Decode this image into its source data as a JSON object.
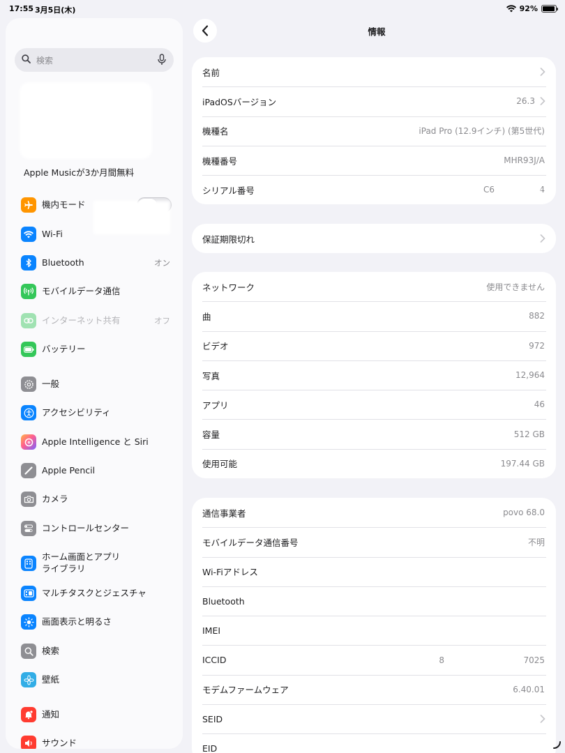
{
  "status": {
    "time": "17:55",
    "date": "3月5日(木)",
    "battery": "92%",
    "battery_level": 0.92
  },
  "sidebar": {
    "search_placeholder": "検索",
    "promo": "Apple Musicが3か月間無料",
    "items": [
      {
        "label": "機内モード",
        "value": "",
        "color": "#ff9500",
        "icon": "airplane-icon"
      },
      {
        "label": "Wi-Fi",
        "value": "",
        "color": "#0a84ff",
        "icon": "wifi-icon"
      },
      {
        "label": "Bluetooth",
        "value": "オン",
        "color": "#0a84ff",
        "icon": "bluetooth-icon"
      },
      {
        "label": "モバイルデータ通信",
        "value": "",
        "color": "#34c759",
        "icon": "antenna-icon"
      },
      {
        "label": "インターネット共有",
        "value": "オフ",
        "color": "#34c759",
        "icon": "link-icon"
      },
      {
        "label": "バッテリー",
        "value": "",
        "color": "#34c759",
        "icon": "battery-icon"
      },
      {
        "label": "一般",
        "value": "",
        "color": "#8e8e93",
        "icon": "gear-icon"
      },
      {
        "label": "アクセシビリティ",
        "value": "",
        "color": "#0a84ff",
        "icon": "accessibility-icon"
      },
      {
        "label": "Apple Intelligence と Siri",
        "value": "",
        "color": "#ff6ea8",
        "icon": "siri-icon"
      },
      {
        "label": "Apple Pencil",
        "value": "",
        "color": "#8e8e93",
        "icon": "pencil-icon"
      },
      {
        "label": "カメラ",
        "value": "",
        "color": "#8e8e93",
        "icon": "camera-icon"
      },
      {
        "label": "コントロールセンター",
        "value": "",
        "color": "#8e8e93",
        "icon": "toggles-icon"
      },
      {
        "label": "ホーム画面とアプリ",
        "label2": "ライブラリ",
        "value": "",
        "color": "#0a84ff",
        "icon": "home-screen-icon"
      },
      {
        "label": "マルチタスクとジェスチャ",
        "value": "",
        "color": "#0a84ff",
        "icon": "multitask-icon"
      },
      {
        "label": "画面表示と明るさ",
        "value": "",
        "color": "#0a84ff",
        "icon": "sun-icon"
      },
      {
        "label": "検索",
        "value": "",
        "color": "#8e8e93",
        "icon": "search-icon"
      },
      {
        "label": "壁紙",
        "value": "",
        "color": "#32ade6",
        "icon": "flower-icon"
      },
      {
        "label": "通知",
        "value": "",
        "color": "#ff3b30",
        "icon": "bell-icon"
      },
      {
        "label": "サウンド",
        "value": "",
        "color": "#ff3b30",
        "icon": "speaker-icon"
      }
    ]
  },
  "main": {
    "title": "情報",
    "group1": [
      {
        "key": "名前",
        "value": ""
      },
      {
        "key": "iPadOSバージョン",
        "value": "26.3"
      },
      {
        "key": "機種名",
        "value": "iPad Pro (12.9インチ) (第5世代)"
      },
      {
        "key": "機種番号",
        "value": "MHR93J/A"
      },
      {
        "key": "シリアル番号",
        "value": "C6"
      }
    ],
    "group2": [
      {
        "key": "保証期限切れ",
        "value": ""
      }
    ],
    "group3": [
      {
        "key": "ネットワーク",
        "value": "使用できません"
      },
      {
        "key": "曲",
        "value": "882"
      },
      {
        "key": "ビデオ",
        "value": "972"
      },
      {
        "key": "写真",
        "value": "12,964"
      },
      {
        "key": "アプリ",
        "value": "46"
      },
      {
        "key": "容量",
        "value": "512 GB"
      },
      {
        "key": "使用可能",
        "value": "197.44 GB"
      }
    ],
    "group4": [
      {
        "key": "通信事業者",
        "value": "povo 68.0"
      },
      {
        "key": "モバイルデータ通信番号",
        "value": "不明"
      },
      {
        "key": "Wi-Fiアドレス",
        "value": ""
      },
      {
        "key": "Bluetooth",
        "value": ""
      },
      {
        "key": "IMEI",
        "value": ""
      },
      {
        "key": "ICCID",
        "value": "7025"
      },
      {
        "key": "モデムファームウェア",
        "value": "6.40.01"
      },
      {
        "key": "SEID",
        "value": ""
      },
      {
        "key": "EID",
        "value": ""
      }
    ]
  }
}
